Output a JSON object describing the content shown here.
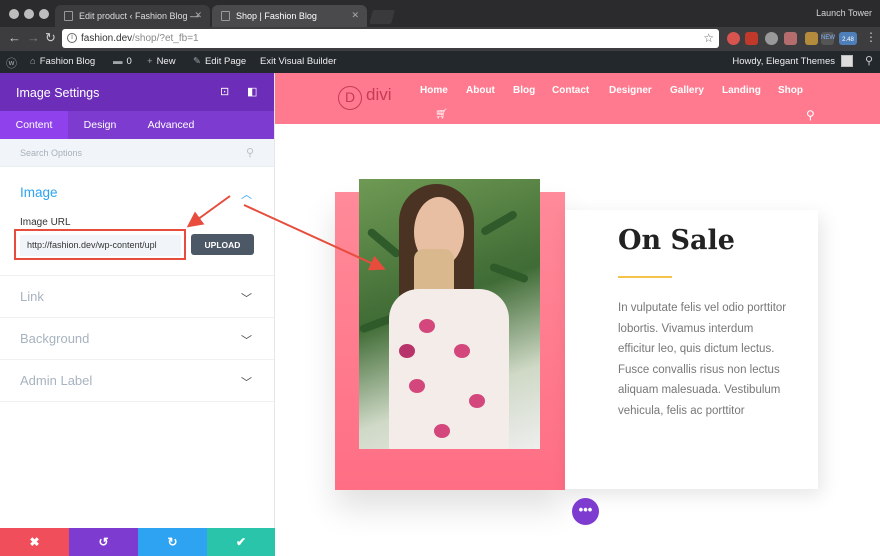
{
  "browser": {
    "tabs": [
      {
        "title": "Edit product ‹ Fashion Blog —"
      },
      {
        "title": "Shop | Fashion Blog"
      }
    ],
    "profile_name": "Launch Tower",
    "url_host": "fashion.dev",
    "url_path": "/shop/?et_fb=1",
    "extension_badge": "2.48",
    "extension_new": "NEW"
  },
  "adminbar": {
    "site_name": "Fashion Blog",
    "comments_count": "0",
    "new_label": "New",
    "edit_page": "Edit Page",
    "exit_builder": "Exit Visual Builder",
    "howdy": "Howdy, Elegant Themes"
  },
  "panel": {
    "title": "Image Settings",
    "tabs": [
      "Content",
      "Design",
      "Advanced"
    ],
    "search_placeholder": "Search Options",
    "section_image": "Image",
    "image_url_label": "Image URL",
    "image_url_value": "http://fashion.dev/wp-content/upl",
    "upload_label": "UPLOAD",
    "sections": [
      "Link",
      "Background",
      "Admin Label"
    ],
    "footer_colors": [
      "#ef4e5a",
      "#7e3bd0",
      "#2ea3f2",
      "#29c4a9"
    ]
  },
  "site": {
    "logo_letter": "D",
    "logo_text": "divi",
    "menu": [
      "Home",
      "About",
      "Blog",
      "Contact",
      "Designer",
      "Gallery",
      "Landing",
      "Shop"
    ],
    "heading": "On Sale",
    "body": "In vulputate felis vel odio porttitor lobortis. Vivamus interdum efficitur leo, quis dictum lectus. Fusce convallis risus non lectus aliquam malesuada. Vestibulum vehicula, felis ac porttitor",
    "accent": "#ff7a8f"
  }
}
